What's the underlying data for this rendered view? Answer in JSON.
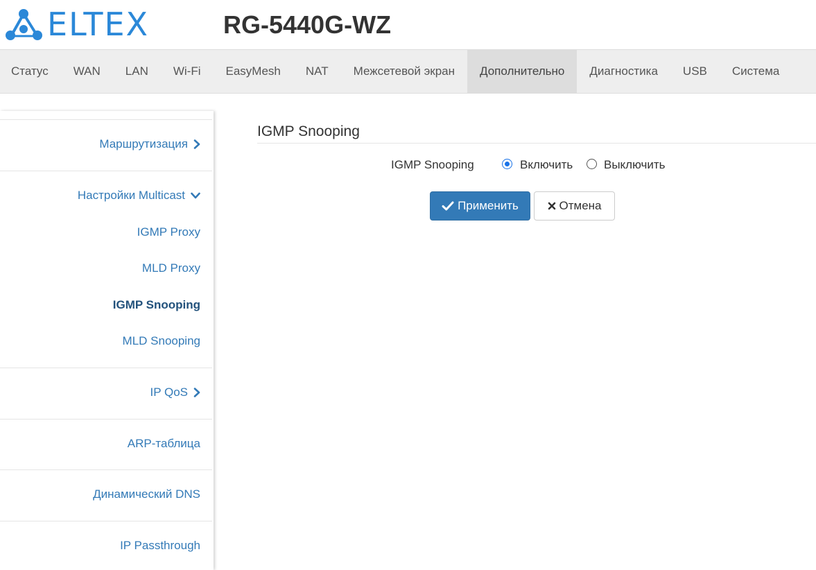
{
  "header": {
    "logo_text": "ELTEX",
    "device_model": "RG-5440G-WZ"
  },
  "topnav": {
    "tabs": [
      {
        "label": "Статус"
      },
      {
        "label": "WAN"
      },
      {
        "label": "LAN"
      },
      {
        "label": "Wi-Fi"
      },
      {
        "label": "EasyMesh"
      },
      {
        "label": "NAT"
      },
      {
        "label": "Межсетевой экран"
      },
      {
        "label": "Дополнительно",
        "active": true
      },
      {
        "label": "Диагностика"
      },
      {
        "label": "USB"
      },
      {
        "label": "Система"
      }
    ]
  },
  "sidebar": {
    "routing": "Маршрутизация",
    "multicast": "Настройки Multicast",
    "igmp_proxy": "IGMP Proxy",
    "mld_proxy": "MLD Proxy",
    "igmp_snooping": "IGMP Snooping",
    "mld_snooping": "MLD Snooping",
    "ip_qos": "IP QoS",
    "arp_table": "ARP-таблица",
    "dynamic_dns": "Динамический DNS",
    "ip_passthrough": "IP Passthrough"
  },
  "main": {
    "section_title": "IGMP Snooping",
    "field_label": "IGMP Snooping",
    "option_enable": "Включить",
    "option_disable": "Выключить",
    "selected": "Включить",
    "apply_label": "Применить",
    "cancel_label": "Отмена"
  },
  "colors": {
    "brand": "#2b88d8",
    "link": "#337ab7",
    "primary_button": "#337ab7",
    "nav_bg": "#eeeeee",
    "nav_active_bg": "#dddddd"
  },
  "icons": {
    "logo": "eltex-molecule-logo",
    "chevron_right": "chevron-right-icon",
    "chevron_down": "chevron-down-icon",
    "apply": "check-icon",
    "cancel": "close-icon"
  }
}
